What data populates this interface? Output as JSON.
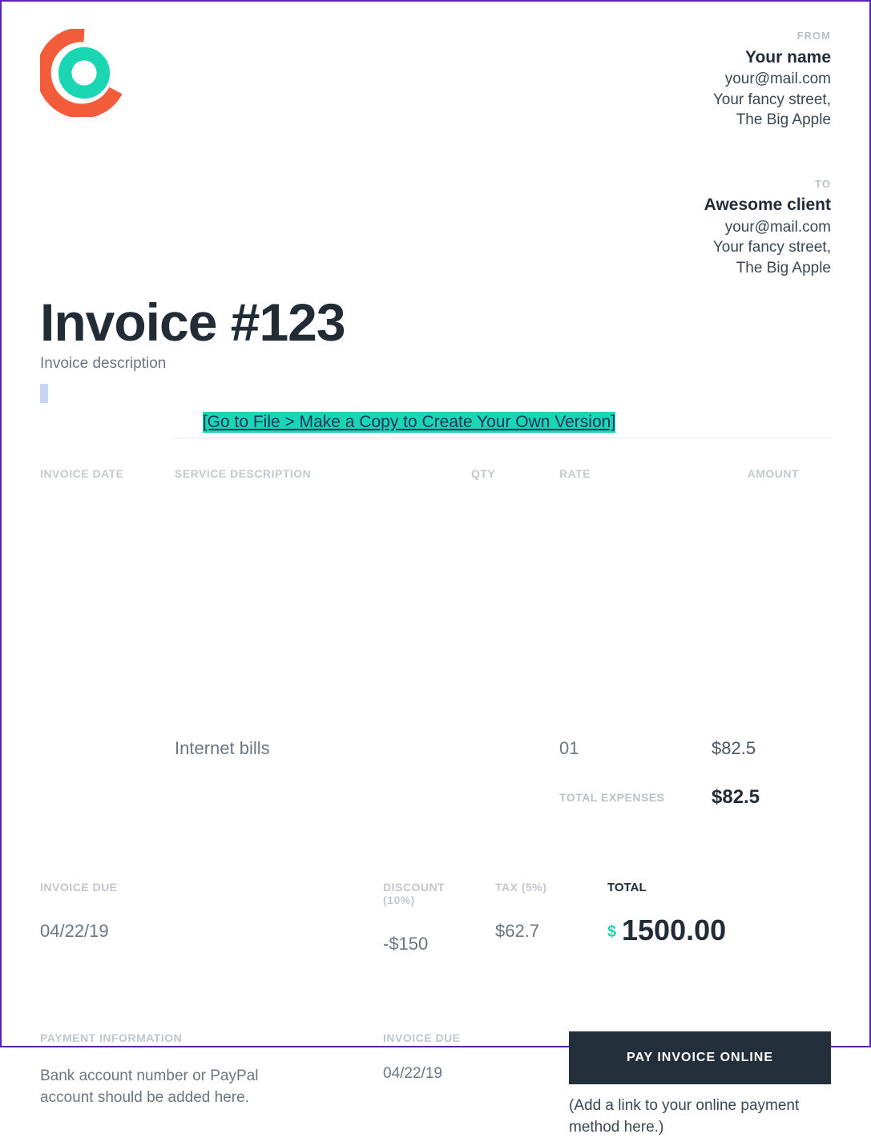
{
  "from": {
    "label": "FROM",
    "name": "Your name",
    "email": "your@mail.com",
    "street": "Your fancy street,",
    "city": "The Big Apple"
  },
  "to": {
    "label": "TO",
    "name": "Awesome client",
    "email": "your@mail.com",
    "street": "Your fancy street,",
    "city": "The Big Apple"
  },
  "invoice": {
    "title": "Invoice #123",
    "description": "Invoice description"
  },
  "instruction": "[Go to File > Make a Copy to Create Your Own Version]",
  "columns": {
    "date": "INVOICE DATE",
    "service": "SERVICE DESCRIPTION",
    "qty": "QTY",
    "rate": "RATE",
    "amount": "AMOUNT"
  },
  "line_item": {
    "service": "Internet bills",
    "qty": "01",
    "amount": "$82.5"
  },
  "expenses": {
    "label": "TOTAL EXPENSES",
    "value": "$82.5"
  },
  "summary": {
    "due_label": "INVOICE DUE",
    "due_value": "04/22/19",
    "discount_label": "DISCOUNT (10%)",
    "discount_value": "-$150",
    "tax_label": "TAX (5%)",
    "tax_value": "$62.7",
    "total_label": "TOTAL",
    "total_currency": "$",
    "total_value": "1500.00"
  },
  "payment": {
    "info_label": "PAYMENT INFORMATION",
    "info_text": "Bank account number or PayPal account should be added here.",
    "due_label": "INVOICE DUE",
    "due_value": "04/22/19",
    "button": "PAY INVOICE ONLINE",
    "note": "(Add a link to your online payment method here.)"
  }
}
